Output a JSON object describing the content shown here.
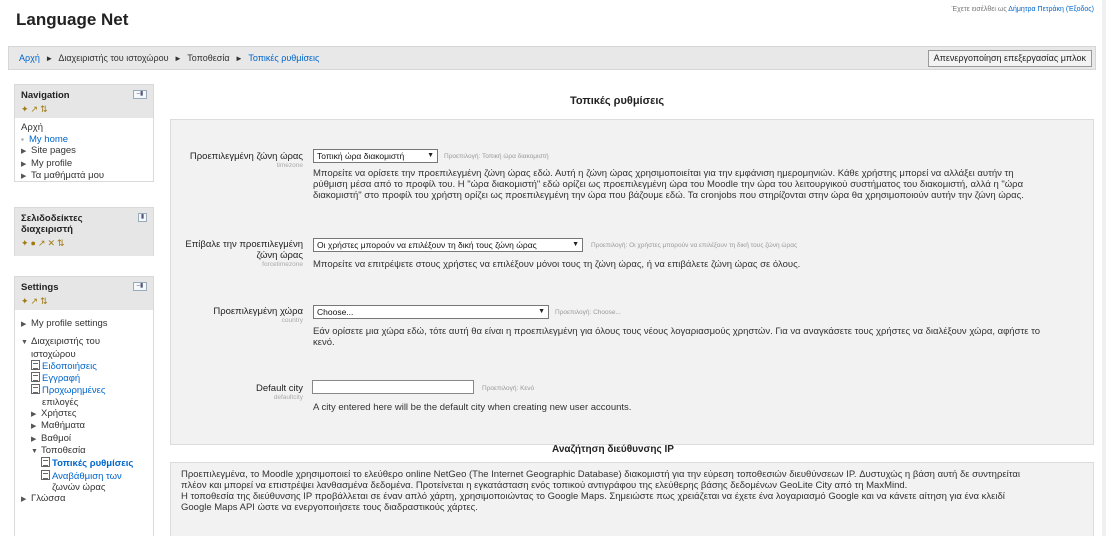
{
  "header": {
    "site_title": "Language Net",
    "login_prefix": "Έχετε εισέλθει ως",
    "login_user": "Δήμητρα Πετράκη",
    "logout": "(Έξοδος)"
  },
  "breadcrumb": {
    "items": [
      "Αρχή",
      "Διαχειριστής του ιστοχώρου",
      "Τοποθεσία",
      "Τοπικές ρυθμίσεις"
    ],
    "separator": "►"
  },
  "edit_button": "Απενεργοποίηση επεξεργασίας μπλοκ",
  "navigation_block": {
    "title": "Navigation",
    "home": "Αρχή",
    "items": [
      "My home",
      "Site pages",
      "My profile",
      "Τα μαθήματά μου"
    ]
  },
  "bookmarks_block": {
    "title_line1": "Σελιδοδείκτες",
    "title_line2": "διαχειριστή"
  },
  "settings_block": {
    "title": "Settings",
    "my_profile_settings": "My profile settings",
    "admin_line1": "Διαχειριστής του",
    "admin_line2": "ιστοχώρου",
    "notifications": "Ειδοποιήσεις",
    "registration": "Εγγραφή",
    "advanced_line1": "Προχωρημένες",
    "advanced_line2": "επιλογές",
    "users": "Χρήστες",
    "courses": "Μαθήματα",
    "grades": "Βαθμοί",
    "location": "Τοποθεσία",
    "local_settings": "Τοπικές ρυθμίσεις",
    "tz_update_line1": "Αναβάθμιση των",
    "tz_update_line2": "ζωνών ώρας",
    "language": "Γλώσσα"
  },
  "main": {
    "heading": "Τοπικές ρυθμίσεις",
    "timezone": {
      "label": "Προεπιλεγμένη ζώνη ώρας",
      "key": "timezone",
      "value": "Τοπική ώρα διακομιστή",
      "default": "Προεπιλογή: Τοπική ώρα διακομιστή",
      "desc_line1": "Μπορείτε να ορίσετε την προεπιλεγμένη ζώνη ώρας εδώ. Αυτή η ζώνη ώρας χρησιμοποιείται για την εμφάνιση ημερομηνιών. Κάθε χρήστης μπορεί να αλλάξει αυτήν τη",
      "desc_line2": "ρύθμιση μέσα από το προφίλ του. Η \"ώρα διακομιστή\" εδώ ορίζει ως προεπιλεγμένη ώρα του Moodle την ώρα του λειτουργικού συστήματος του διακομιστή, αλλά η \"ώρα",
      "desc_line3": "διακομιστή\" στο προφίλ του χρήστη ορίζει ως προεπιλεγμένη την ώρα που βάζουμε εδώ. Τα cronjobs που στηρίζονται στην ώρα θα χρησιμοποιούν αυτήν την ζώνη ώρας."
    },
    "forcetimezone": {
      "label_line1": "Επίβαλε την προεπιλεγμένη",
      "label_line2": "ζώνη ώρας",
      "key": "forcetimezone",
      "value": "Οι χρήστες μπορούν να επιλέξουν τη δική τους ζώνη ώρας",
      "default": "Προεπιλογή: Οι χρήστες μπορούν να επιλέξουν τη δική τους ζώνη ώρας",
      "desc": "Μπορείτε να επιτρέψετε στους χρήστες να επιλέξουν μόνοι τους τη ζώνη ώρας, ή να επιβάλετε ζώνη ώρας σε όλους."
    },
    "country": {
      "label": "Προεπιλεγμένη χώρα",
      "key": "country",
      "value": "Choose...",
      "default": "Προεπιλογή: Choose...",
      "desc_line1": "Εάν ορίσετε μια χώρα εδώ, τότε αυτή θα είναι η προεπιλεγμένη για όλους τους νέους λογαριασμούς χρηστών. Για να αναγκάσετε τους χρήστες να διαλέξουν χώρα, αφήστε το",
      "desc_line2": "κενό."
    },
    "defaultcity": {
      "label": "Default city",
      "key": "defaultcity",
      "value": "",
      "default": "Προεπιλογή: Κενό",
      "desc": "A city entered here will be the default city when creating new user accounts."
    },
    "ip_section": {
      "heading": "Αναζήτηση διεύθυνσης IP",
      "line1": "Προεπιλεγμένα, το Moodle χρησιμοποιεί το ελεύθερο online NetGeo (The Internet Geographic Database) διακομιστή για την εύρεση τοποθεσιών διευθύνσεων IP. Δυστυχώς η βάση αυτή δε συντηρείται",
      "line2": "πλέον και μπορεί να επιστρέψει λανθασμένα δεδομένα. Προτείνεται η εγκατάσταση ενός τοπικού αντιγράφου της ελεύθερης βάσης δεδομένων GeoLite City από τη MaxMind.",
      "line3": "Η τοποθεσία της διεύθυνσης IP προβάλλεται σε έναν απλό χάρτη, χρησιμοποιώντας το Google Maps. Σημειώστε πως χρειάζεται να έχετε ένα λογαριασμό Google και να κάνετε αίτηση για ένα κλειδί",
      "line4": "Google Maps API ώστε να ενεργοποιήσετε τους διαδραστικούς χάρτες."
    }
  }
}
